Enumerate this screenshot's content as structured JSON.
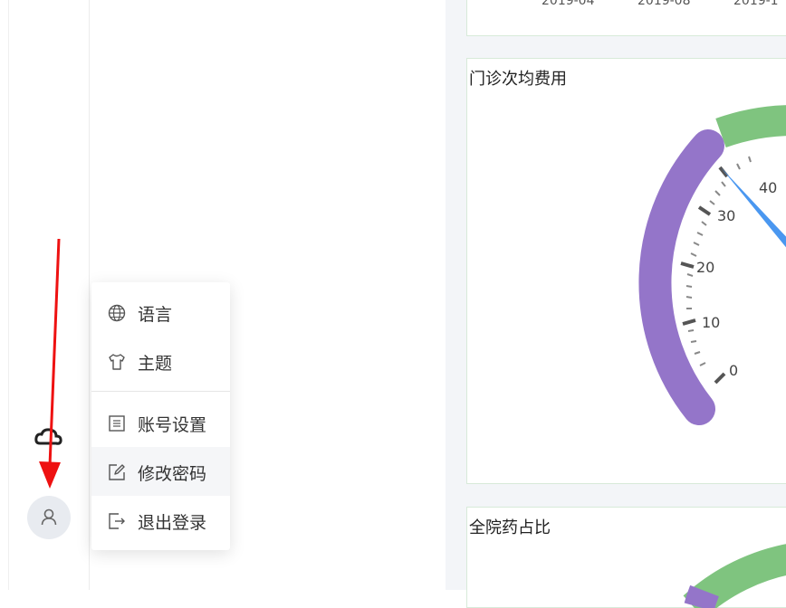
{
  "menu": {
    "items": [
      {
        "label": "语言",
        "icon": "globe-icon"
      },
      {
        "label": "主题",
        "icon": "tshirt-icon"
      },
      {
        "label": "账号设置",
        "icon": "list-icon"
      },
      {
        "label": "修改密码",
        "icon": "edit-icon"
      },
      {
        "label": "退出登录",
        "icon": "logout-icon"
      }
    ]
  },
  "dashboard": {
    "top_chart": {
      "x_ticks": [
        "2019-04",
        "2019-08",
        "2019-1"
      ]
    },
    "fee_card": {
      "title": "门诊次均费用",
      "gauge": {
        "tick_labels": [
          "0",
          "10",
          "20",
          "30",
          "40"
        ],
        "colors": {
          "purple": "#9475c9",
          "green": "#7fc47f",
          "needle": "#4a97f0"
        }
      }
    },
    "drug_card": {
      "title": "全院药占比"
    }
  },
  "colors": {
    "arrow": "#ee1111",
    "menu_bg": "#ffffff",
    "avatar_bg": "#e8ebf0"
  }
}
